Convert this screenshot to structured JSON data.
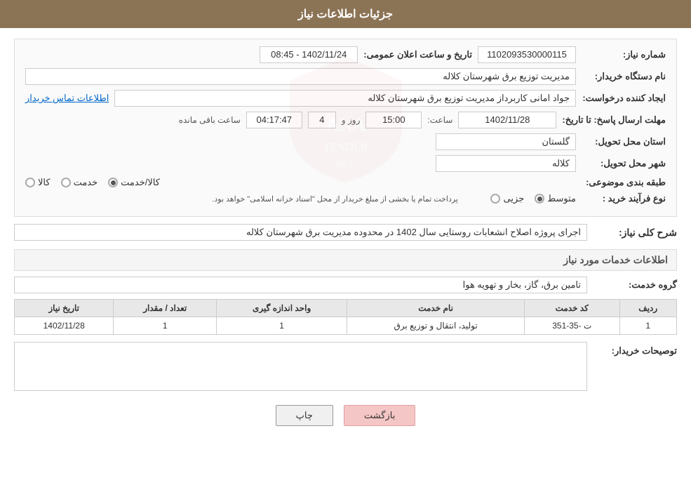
{
  "header": {
    "title": "جزئیات اطلاعات نیاز"
  },
  "form": {
    "need_number_label": "شماره نیاز:",
    "need_number_value": "1102093530000115",
    "announce_datetime_label": "تاریخ و ساعت اعلان عمومی:",
    "announce_datetime_value": "1402/11/24 - 08:45",
    "buyer_org_label": "نام دستگاه خریدار:",
    "buyer_org_value": "مدیریت توزیع برق شهرستان کلاله",
    "requester_label": "ایجاد کننده درخواست:",
    "requester_value": "جواد امانی کاربرداز مدیریت توزیع برق شهرستان کلاله",
    "contact_link": "اطلاعات تماس خریدار",
    "response_deadline_label": "مهلت ارسال پاسخ: تا تاریخ:",
    "response_date_value": "1402/11/28",
    "response_time_label": "ساعت:",
    "response_time_value": "15:00",
    "remaining_days_label": "روز و",
    "remaining_days_value": "4",
    "remaining_time_label": "ساعت باقی مانده",
    "remaining_time_value": "04:17:47",
    "province_label": "استان محل تحویل:",
    "province_value": "گلستان",
    "city_label": "شهر محل تحویل:",
    "city_value": "کلاله",
    "category_label": "طبقه بندی موضوعی:",
    "category_options": [
      {
        "label": "کالا",
        "selected": false
      },
      {
        "label": "خدمت",
        "selected": false
      },
      {
        "label": "کالا/خدمت",
        "selected": true
      }
    ],
    "purchase_type_label": "نوع فرآیند خرید :",
    "purchase_type_options": [
      {
        "label": "جزیی",
        "selected": false
      },
      {
        "label": "متوسط",
        "selected": true
      }
    ],
    "purchase_type_note": "پرداخت تمام یا بخشی از مبلغ خریدار از محل \"اسناد خزانه اسلامی\" خواهد بود.",
    "general_desc_label": "شرح کلی نیاز:",
    "general_desc_value": "اجرای پروژه اصلاح انشعابات روستایی سال 1402 در محدوده مدیریت برق شهرستان کلاله",
    "services_section_title": "اطلاعات خدمات مورد نیاز",
    "service_group_label": "گروه خدمت:",
    "service_group_value": "تامین برق، گاز، بخار و تهویه هوا",
    "table": {
      "headers": [
        "ردیف",
        "کد خدمت",
        "نام خدمت",
        "واحد اندازه گیری",
        "تعداد / مقدار",
        "تاریخ نیاز"
      ],
      "rows": [
        {
          "row_num": "1",
          "service_code": "ت -35-351",
          "service_name": "تولید، انتقال و توزیع برق",
          "unit": "1",
          "quantity": "1",
          "date": "1402/11/28"
        }
      ]
    },
    "buyer_notes_label": "توصیحات خریدار:"
  },
  "buttons": {
    "print": "چاپ",
    "back": "بازگشت"
  }
}
